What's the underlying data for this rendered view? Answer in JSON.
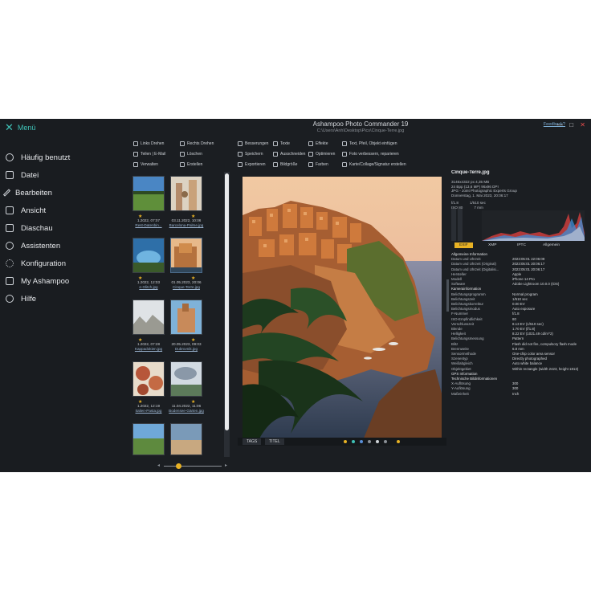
{
  "app": {
    "title": "Ashampoo Photo Commander 19",
    "path": "C:\\Users\\Anh\\Desktop\\Pics\\Cinque-Terre.jpg",
    "feedback": "Feedback?",
    "window_controls": [
      "—",
      "□",
      "✕"
    ]
  },
  "menu": {
    "header": "Menü",
    "items": [
      {
        "label": "Häufig benutzt",
        "icon": "clock-icon"
      },
      {
        "label": "Datei",
        "icon": "file-icon"
      },
      {
        "label": "Bearbeiten",
        "icon": "pencil-icon"
      },
      {
        "label": "Ansicht",
        "icon": "view-icon"
      },
      {
        "label": "Diaschau",
        "icon": "slideshow-icon"
      },
      {
        "label": "Assistenten",
        "icon": "wizard-icon"
      },
      {
        "label": "Konfiguration",
        "icon": "gear-icon"
      },
      {
        "label": "My Ashampoo",
        "icon": "account-icon"
      },
      {
        "label": "Hilfe",
        "icon": "help-icon"
      }
    ]
  },
  "toolbar": {
    "rotate_left": "Links Drehen",
    "rotate_right": "Rechts Drehen",
    "share": "Teilen | E-Mail",
    "delete": "Löschen",
    "manage": "Verwalten",
    "create": "Erstellen",
    "improve": "Besserungen",
    "text": "Texte",
    "effects": "Effekte",
    "text_add": "Text, Pfeil, Objekt einfügen",
    "save": "Speichern",
    "crop": "Ausschneiden",
    "optimize": "Optimieren",
    "photo_fix": "Foto verbessern, reparieren",
    "export": "Exportieren",
    "resize": "Bildgröße",
    "color": "Farben",
    "postcard": "Karte/Collage/Signatur erstellen"
  },
  "thumbnails": [
    {
      "date": "1.2022, 07:07",
      "name": "Rest-Datenbin...",
      "starred": true
    },
    {
      "date": "03.11.2022, 10:06",
      "name": "Barcelona-Palme.jpg",
      "starred": true
    },
    {
      "date": "1.2022, 12:03",
      "name": "e-Glitch.jpg",
      "starred": true
    },
    {
      "date": "01.05.2023, 20:06",
      "name": "Cinque-Terre.jpg",
      "starred": true,
      "selected": true
    },
    {
      "date": "1.2022, 07:28",
      "name": "Kappadokien.jpg",
      "starred": true
    },
    {
      "date": "20.05.2023, 09:03",
      "name": "Dubrovnik.jpg",
      "starred": true
    },
    {
      "date": "1.2022, 12:19",
      "name": "Italien-Pasta.jpg",
      "starred": true
    },
    {
      "date": "11.04.2022, 11:06",
      "name": "Bodensee-Gärten.jpg",
      "starred": true
    }
  ],
  "zoom_level": 0.25,
  "preview_bar": {
    "tags": "TAGS",
    "title": "TITEL"
  },
  "info": {
    "filename": "Cinque-Terre.jpg",
    "summary": [
      "3146x4322 px     4,35 MB",
      "24 Bpp (13,6 MP) 96x96 DPI",
      "JPG - Joint Photographic Experts Group",
      "Donnerstag, 1. Mai 2023, 20:06:17"
    ],
    "camera": [
      "f/1.8",
      "1/510 sec",
      "ISO 80",
      "7 mm"
    ],
    "tabs": [
      "EXIF",
      "XMP",
      "IPTC",
      "Allgemein"
    ],
    "active_tab": "EXIF",
    "rows": [
      {
        "k": "Allgemeine Information",
        "v": "",
        "section": true
      },
      {
        "k": "Datum und Uhrzeit",
        "v": "2023:05:01 22:06:09"
      },
      {
        "k": "Datum und Uhrzeit (Original)",
        "v": "2023:05:01 20:06:17"
      },
      {
        "k": "Datum und Uhrzeit (Digitalisi...",
        "v": "2023:05:01 20:06:17"
      },
      {
        "k": "Hersteller",
        "v": "Apple"
      },
      {
        "k": "Modell",
        "v": "iPhone 14 Pro"
      },
      {
        "k": "Software",
        "v": "Adobe Lightroom 10.0.0 (iOS)"
      },
      {
        "k": "",
        "v": ""
      },
      {
        "k": "Kamerainformation",
        "v": "",
        "section": true
      },
      {
        "k": "Belichtungsprogramm",
        "v": "Normal program"
      },
      {
        "k": "Belichtungszeit",
        "v": "1/510 sec"
      },
      {
        "k": "Belichtungskorrektur",
        "v": "0.00 EV"
      },
      {
        "k": "Belichtungsmodus",
        "v": "Auto exposure"
      },
      {
        "k": "F-Nummer",
        "v": "f/1.8"
      },
      {
        "k": "ISO-Empfindlichkeit",
        "v": "80"
      },
      {
        "k": "Verschlusszeit",
        "v": "8.13 EV (1/510 sec)"
      },
      {
        "k": "Blende",
        "v": "1.70 EV (f/1.8)"
      },
      {
        "k": "Helligkeit",
        "v": "8.22 EV (1021.49 cd/m^2)"
      },
      {
        "k": "Belichtungsmessung",
        "v": "Pattern"
      },
      {
        "k": "Blitz",
        "v": "Flash did not fire, compulsory flash mode"
      },
      {
        "k": "Brennweite",
        "v": "6.8 mm"
      },
      {
        "k": "Sensormethode",
        "v": "One-chip color area sensor"
      },
      {
        "k": "Szenentyp",
        "v": "Directly photographed"
      },
      {
        "k": "Weißabgleich",
        "v": "Auto white balance"
      },
      {
        "k": "Objektgebiet",
        "v": "Within rectangle (width 2423, height 1813)"
      },
      {
        "k": "",
        "v": ""
      },
      {
        "k": "GPS Information",
        "v": "",
        "section": true
      },
      {
        "k": "",
        "v": ""
      },
      {
        "k": "Technische Bildinformationen",
        "v": "",
        "section": true
      },
      {
        "k": "X-Auflösung",
        "v": "300"
      },
      {
        "k": "Y-Auflösung",
        "v": "300"
      },
      {
        "k": "Maßeinheit",
        "v": "Inch"
      }
    ]
  },
  "colors": {
    "accent": "#3fc1b6",
    "star": "#e8b224",
    "background": "#1b1e22"
  }
}
